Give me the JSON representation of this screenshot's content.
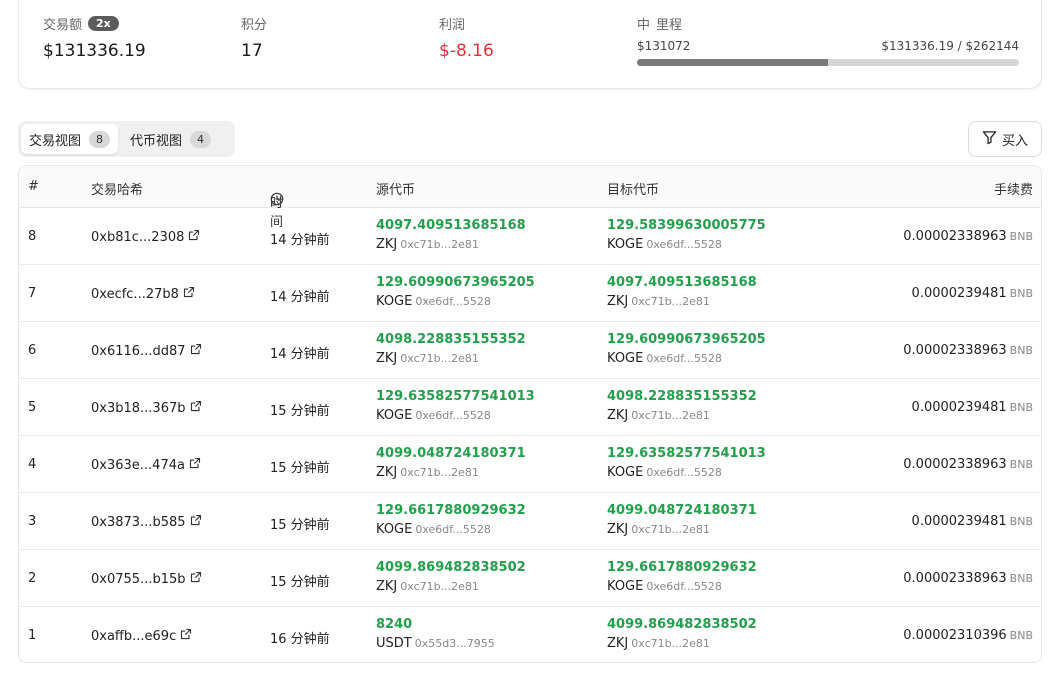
{
  "stats": {
    "volume": {
      "label": "交易额",
      "badge": "2x",
      "value": "$131336.19"
    },
    "points": {
      "label": "积分",
      "value": "17"
    },
    "profit": {
      "label": "利润",
      "value": "$-8.16"
    },
    "milestone": {
      "icon_text": "中",
      "label": "里程",
      "start": "$131072",
      "progress_text": "$131336.19 / $262144",
      "progress_fraction": 0.501
    }
  },
  "tabs": [
    {
      "label": "交易视图",
      "count": "8"
    },
    {
      "label": "代币视图",
      "count": "4"
    }
  ],
  "filter": {
    "label": "买入"
  },
  "table": {
    "headers": {
      "idx": "#",
      "hash": "交易哈希",
      "time": "时间",
      "source": "源代币",
      "target": "目标代币",
      "fee": "手续费"
    },
    "rows": [
      {
        "idx": "8",
        "hash": "0xb81c...2308",
        "time": "14 分钟前",
        "src_amt": "4097.409513685168",
        "src_tok": "ZKJ",
        "src_addr": "0xc71b...2e81",
        "dst_amt": "129.58399630005775",
        "dst_tok": "KOGE",
        "dst_addr": "0xe6df...5528",
        "fee": "0.00002338963",
        "fee_unit": "BNB"
      },
      {
        "idx": "7",
        "hash": "0xecfc...27b8",
        "time": "14 分钟前",
        "src_amt": "129.60990673965205",
        "src_tok": "KOGE",
        "src_addr": "0xe6df...5528",
        "dst_amt": "4097.409513685168",
        "dst_tok": "ZKJ",
        "dst_addr": "0xc71b...2e81",
        "fee": "0.0000239481",
        "fee_unit": "BNB"
      },
      {
        "idx": "6",
        "hash": "0x6116...dd87",
        "time": "14 分钟前",
        "src_amt": "4098.228835155352",
        "src_tok": "ZKJ",
        "src_addr": "0xc71b...2e81",
        "dst_amt": "129.60990673965205",
        "dst_tok": "KOGE",
        "dst_addr": "0xe6df...5528",
        "fee": "0.00002338963",
        "fee_unit": "BNB"
      },
      {
        "idx": "5",
        "hash": "0x3b18...367b",
        "time": "15 分钟前",
        "src_amt": "129.63582577541013",
        "src_tok": "KOGE",
        "src_addr": "0xe6df...5528",
        "dst_amt": "4098.228835155352",
        "dst_tok": "ZKJ",
        "dst_addr": "0xc71b...2e81",
        "fee": "0.0000239481",
        "fee_unit": "BNB"
      },
      {
        "idx": "4",
        "hash": "0x363e...474a",
        "time": "15 分钟前",
        "src_amt": "4099.048724180371",
        "src_tok": "ZKJ",
        "src_addr": "0xc71b...2e81",
        "dst_amt": "129.63582577541013",
        "dst_tok": "KOGE",
        "dst_addr": "0xe6df...5528",
        "fee": "0.00002338963",
        "fee_unit": "BNB"
      },
      {
        "idx": "3",
        "hash": "0x3873...b585",
        "time": "15 分钟前",
        "src_amt": "129.6617880929632",
        "src_tok": "KOGE",
        "src_addr": "0xe6df...5528",
        "dst_amt": "4099.048724180371",
        "dst_tok": "ZKJ",
        "dst_addr": "0xc71b...2e81",
        "fee": "0.0000239481",
        "fee_unit": "BNB"
      },
      {
        "idx": "2",
        "hash": "0x0755...b15b",
        "time": "15 分钟前",
        "src_amt": "4099.869482838502",
        "src_tok": "ZKJ",
        "src_addr": "0xc71b...2e81",
        "dst_amt": "129.6617880929632",
        "dst_tok": "KOGE",
        "dst_addr": "0xe6df...5528",
        "fee": "0.00002338963",
        "fee_unit": "BNB"
      },
      {
        "idx": "1",
        "hash": "0xaffb...e69c",
        "time": "16 分钟前",
        "src_amt": "8240",
        "src_tok": "USDT",
        "src_addr": "0x55d3...7955",
        "dst_amt": "4099.869482838502",
        "dst_tok": "ZKJ",
        "dst_addr": "0xc71b...2e81",
        "fee": "0.00002310396",
        "fee_unit": "BNB"
      }
    ]
  },
  "colors": {
    "positive": "#22a04b",
    "negative": "#e0313b"
  },
  "icons": {
    "external_link": "external-link-icon",
    "clock": "clock-icon",
    "filter": "filter-icon"
  }
}
